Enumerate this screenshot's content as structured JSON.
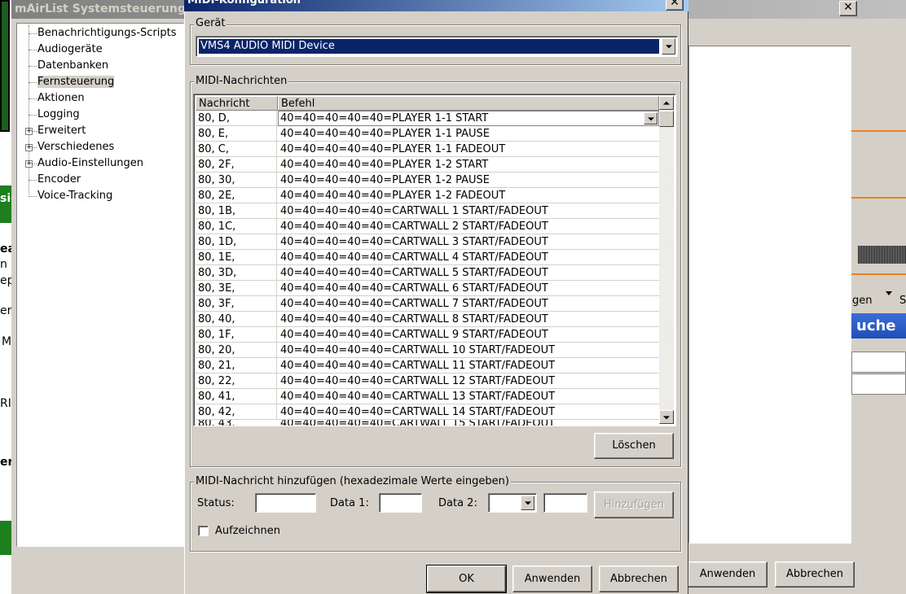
{
  "background_window": {
    "title": "mAirList Systemsteuerung",
    "tree": [
      {
        "label": "Benachrichtigungs-Scripts",
        "expandable": false
      },
      {
        "label": "Audiogeräte",
        "expandable": false
      },
      {
        "label": "Datenbanken",
        "expandable": false
      },
      {
        "label": "Fernsteuerung",
        "expandable": false,
        "selected": true
      },
      {
        "label": "Aktionen",
        "expandable": false
      },
      {
        "label": "Logging",
        "expandable": false
      },
      {
        "label": "Erweitert",
        "expandable": true
      },
      {
        "label": "Verschiedenes",
        "expandable": true
      },
      {
        "label": "Audio-Einstellungen",
        "expandable": true
      },
      {
        "label": "Encoder",
        "expandable": false
      },
      {
        "label": "Voice-Tracking",
        "expandable": false
      }
    ],
    "apply_label": "Anwenden",
    "cancel_label": "Abbrechen",
    "right_fragments": {
      "menu1": "gen",
      "menu2": "S",
      "search": "uche"
    },
    "left_fragments": [
      "sic",
      "ea",
      "n",
      "ep",
      "er",
      "M",
      "RI",
      "er"
    ]
  },
  "dialog": {
    "title": "MIDI-Konfiguration",
    "device_group_label": "Gerät",
    "device_value": "VMS4 AUDIO MIDI Device",
    "messages_group_label": "MIDI-Nachrichten",
    "columns": [
      "Nachricht",
      "Befehl"
    ],
    "rows": [
      {
        "msg": "80,  D,",
        "cmd": "40=40=40=40=40=PLAYER 1-1 START"
      },
      {
        "msg": "80,  E,",
        "cmd": "40=40=40=40=40=PLAYER 1-1 PAUSE"
      },
      {
        "msg": "80,  C,",
        "cmd": "40=40=40=40=40=PLAYER 1-1 FADEOUT"
      },
      {
        "msg": "80, 2F,",
        "cmd": "40=40=40=40=40=PLAYER 1-2 START"
      },
      {
        "msg": "80, 30,",
        "cmd": "40=40=40=40=40=PLAYER 1-2 PAUSE"
      },
      {
        "msg": "80, 2E,",
        "cmd": "40=40=40=40=40=PLAYER 1-2 FADEOUT"
      },
      {
        "msg": "80, 1B,",
        "cmd": "40=40=40=40=40=CARTWALL 1 START/FADEOUT"
      },
      {
        "msg": "80, 1C,",
        "cmd": "40=40=40=40=40=CARTWALL 2 START/FADEOUT"
      },
      {
        "msg": "80, 1D,",
        "cmd": "40=40=40=40=40=CARTWALL 3 START/FADEOUT"
      },
      {
        "msg": "80, 1E,",
        "cmd": "40=40=40=40=40=CARTWALL 4 START/FADEOUT"
      },
      {
        "msg": "80, 3D,",
        "cmd": "40=40=40=40=40=CARTWALL 5 START/FADEOUT"
      },
      {
        "msg": "80, 3E,",
        "cmd": "40=40=40=40=40=CARTWALL 6 START/FADEOUT"
      },
      {
        "msg": "80, 3F,",
        "cmd": "40=40=40=40=40=CARTWALL 7 START/FADEOUT"
      },
      {
        "msg": "80, 40,",
        "cmd": "40=40=40=40=40=CARTWALL 8 START/FADEOUT"
      },
      {
        "msg": "80, 1F,",
        "cmd": "40=40=40=40=40=CARTWALL 9 START/FADEOUT"
      },
      {
        "msg": "80, 20,",
        "cmd": "40=40=40=40=40=CARTWALL 10 START/FADEOUT"
      },
      {
        "msg": "80, 21,",
        "cmd": "40=40=40=40=40=CARTWALL 11 START/FADEOUT"
      },
      {
        "msg": "80, 22,",
        "cmd": "40=40=40=40=40=CARTWALL 12 START/FADEOUT"
      },
      {
        "msg": "80, 41,",
        "cmd": "40=40=40=40=40=CARTWALL 13 START/FADEOUT"
      },
      {
        "msg": "80, 42,",
        "cmd": "40=40=40=40=40=CARTWALL 14 START/FADEOUT"
      }
    ],
    "delete_label": "Löschen",
    "add_group_label": "MIDI-Nachricht hinzufügen (hexadezimale Werte eingeben)",
    "status_label": "Status:",
    "data1_label": "Data 1:",
    "data2_label": "Data 2:",
    "status_value": "",
    "data1_value": "",
    "data2_value": "",
    "add_label": "Hinzufügen",
    "record_label": "Aufzeichnen",
    "record_checked": false,
    "ok_label": "OK",
    "apply_label": "Anwenden",
    "cancel_label": "Abbrechen"
  },
  "icons": {
    "close": "close-icon",
    "dropdown": "chevron-down-icon",
    "scroll_up": "scroll-up-icon",
    "scroll_down": "scroll-down-icon"
  }
}
